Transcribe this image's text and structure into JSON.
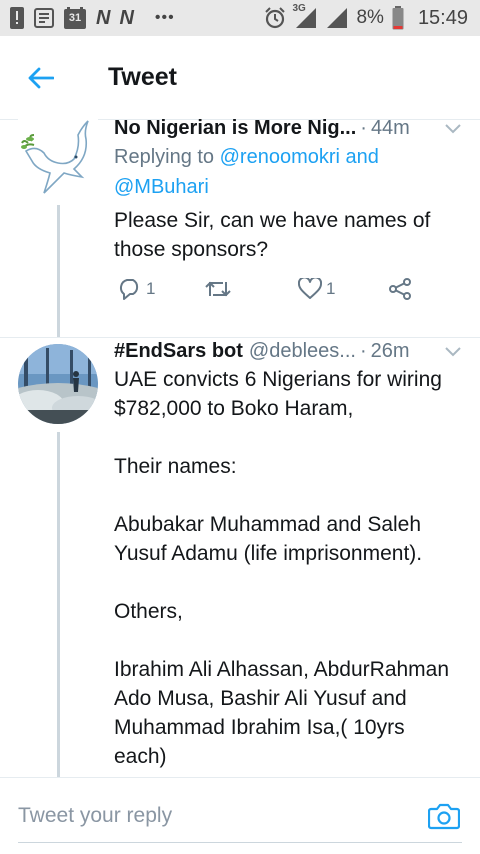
{
  "status_bar": {
    "carrier1": "N",
    "carrier2": "N",
    "calendar_day": "31",
    "more": "•••",
    "network": "3G",
    "battery": "8%",
    "time": "15:49"
  },
  "header": {
    "title": "Tweet"
  },
  "tweets": [
    {
      "name": "No Nigerian is More Nig...",
      "handle": "",
      "time": "44m",
      "reply_prefix": "Replying to ",
      "reply_to_1": "@renoomokri",
      "reply_and": " and",
      "reply_to_2": "@MBuhari",
      "text": "Please Sir, can we have names of those sponsors?",
      "reply_count": "1",
      "like_count": "1"
    },
    {
      "name": "#EndSars bot",
      "handle": "@deblees...",
      "time": "26m",
      "text": "UAE convicts 6 Nigerians for wiring $782,000 to Boko Haram,\n\nTheir names:\n\nAbubakar Muhammad and Saleh Yusuf Adamu (life imprisonment).\n\nOthers,\n\nIbrahim Ali Alhassan, AbdurRahman Ado Musa, Bashir Ali Yusuf and Muhammad Ibrahim Isa,( 10yrs each)"
    }
  ],
  "compose": {
    "placeholder": "Tweet your reply"
  },
  "colors": {
    "accent": "#1da1f2",
    "secondary_text": "#657786"
  }
}
